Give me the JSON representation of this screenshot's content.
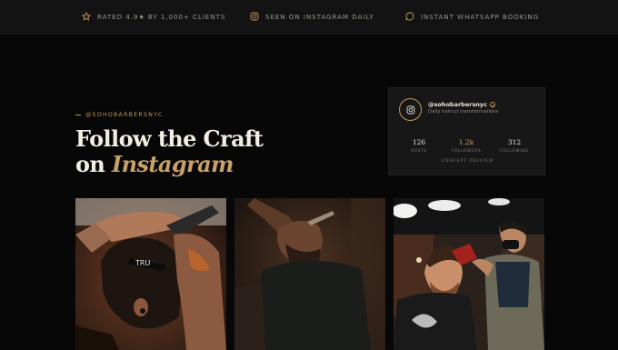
{
  "topbar": {
    "items": [
      {
        "icon": "star-icon",
        "text": "RATED 4.9★ BY 1,000+ CLIENTS"
      },
      {
        "icon": "instagram-icon",
        "text": "SEEN ON INSTAGRAM DAILY"
      },
      {
        "icon": "chat-bubble-icon",
        "text": "INSTANT WHATSAPP BOOKING"
      }
    ]
  },
  "section": {
    "eyebrow": "@SOHOBARBERSNYC",
    "title_line1": "Follow the Craft",
    "title_line2_prefix": "on ",
    "title_line2_accent": "Instagram"
  },
  "profile_card": {
    "handle": "@sohobarbersnyc",
    "bio": "Daily haircut transformations",
    "stats": [
      {
        "value": "126",
        "label": "POSTS"
      },
      {
        "value": "1.2k",
        "label": "FOLLOWERS"
      },
      {
        "value": "312",
        "label": "FOLLOWING"
      }
    ],
    "footer": "CONCEPT PREVIEW"
  },
  "gallery": {
    "photos": [
      {
        "name": "barber-shaving-neck-photo"
      },
      {
        "name": "barber-trimming-beard-photo"
      },
      {
        "name": "barber-blow-drying-hair-photo"
      }
    ]
  },
  "colors": {
    "background": "#070707",
    "topbar": "#131313",
    "accent_gold": "#c49a55",
    "card": "#171717"
  }
}
